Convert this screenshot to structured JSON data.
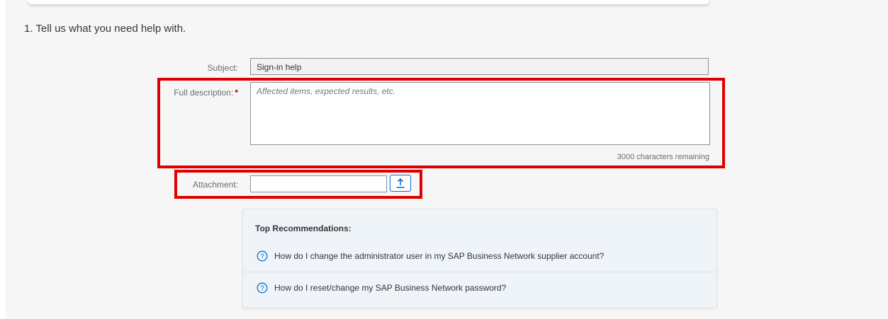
{
  "section": {
    "title": "1. Tell us what you need help with."
  },
  "form": {
    "subject_label": "Subject:",
    "subject_value": "Sign-in help",
    "description_label": "Full description:",
    "required_marker": "*",
    "description_placeholder": "Affected items, expected results, etc.",
    "description_value": "",
    "chars_remaining": "3000 characters remaining",
    "attachment_label": "Attachment:",
    "attachment_value": "",
    "upload_icon": "upload-icon"
  },
  "recommendations": {
    "title": "Top Recommendations:",
    "items": [
      {
        "icon": "help-circle-icon",
        "text": "How do I change the administrator user in my SAP Business Network supplier account?"
      },
      {
        "icon": "help-circle-icon",
        "text": "How do I reset/change my SAP Business Network password?"
      }
    ]
  },
  "colors": {
    "highlight": "#e00000",
    "accent": "#0a6ed1",
    "required": "#bb0000",
    "panel_bg": "#eff4f9"
  }
}
